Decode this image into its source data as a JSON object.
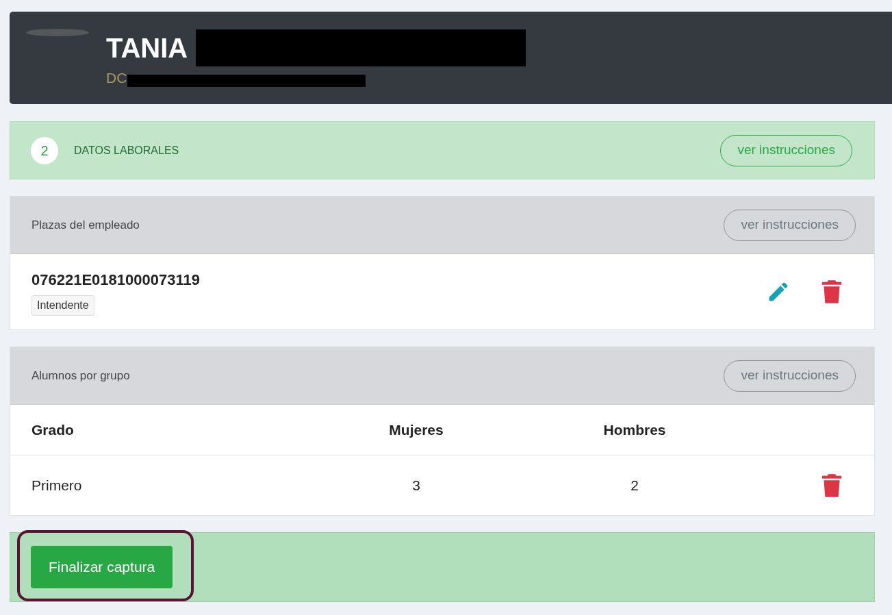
{
  "header": {
    "name": "TANIA",
    "subtitle": "DC"
  },
  "section": {
    "number": "2",
    "title": "DATOS LABORALES",
    "button": "ver instrucciones"
  },
  "plazas": {
    "title": "Plazas del empleado",
    "button": "ver instrucciones",
    "items": [
      {
        "code": "076221E0181000073119",
        "badge": "Intendente"
      }
    ]
  },
  "alumnos": {
    "title": "Alumnos por grupo",
    "button": "ver instrucciones",
    "columns": [
      "Grado",
      "Mujeres",
      "Hombres"
    ],
    "rows": [
      {
        "grado": "Primero",
        "mujeres": "3",
        "hombres": "2"
      }
    ]
  },
  "footer": {
    "button": "Finalizar captura",
    "highlighted": true
  }
}
